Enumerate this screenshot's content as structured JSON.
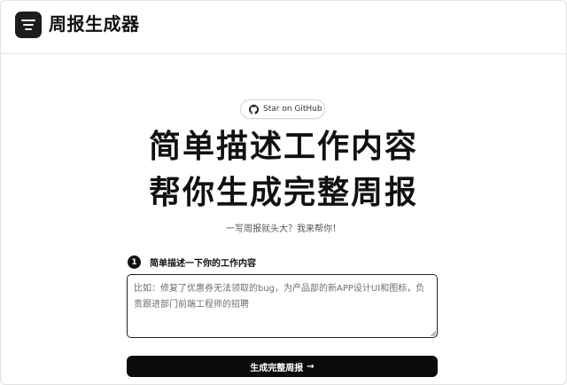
{
  "header": {
    "logo_icon": "list-filter-icon",
    "title": "周报生成器"
  },
  "github_button": {
    "icon": "github-icon",
    "label": "Star on GitHub"
  },
  "hero": {
    "line1": "简单描述工作内容",
    "line2": "帮你生成完整周报"
  },
  "subtitle": "一写周报就头大？我来帮你！",
  "step": {
    "number": "1",
    "label": "简单描述一下你的工作内容"
  },
  "input": {
    "value": "",
    "placeholder": "比如：修复了优惠券无法领取的bug，为产品部的新APP设计UI和图标，负责跟进部门前端工程师的招聘"
  },
  "submit": {
    "label": "生成完整周报",
    "arrow": "→"
  },
  "colors": {
    "primary": "#0b0b0b",
    "background": "#ffffff",
    "border": "#e5e5e5"
  }
}
